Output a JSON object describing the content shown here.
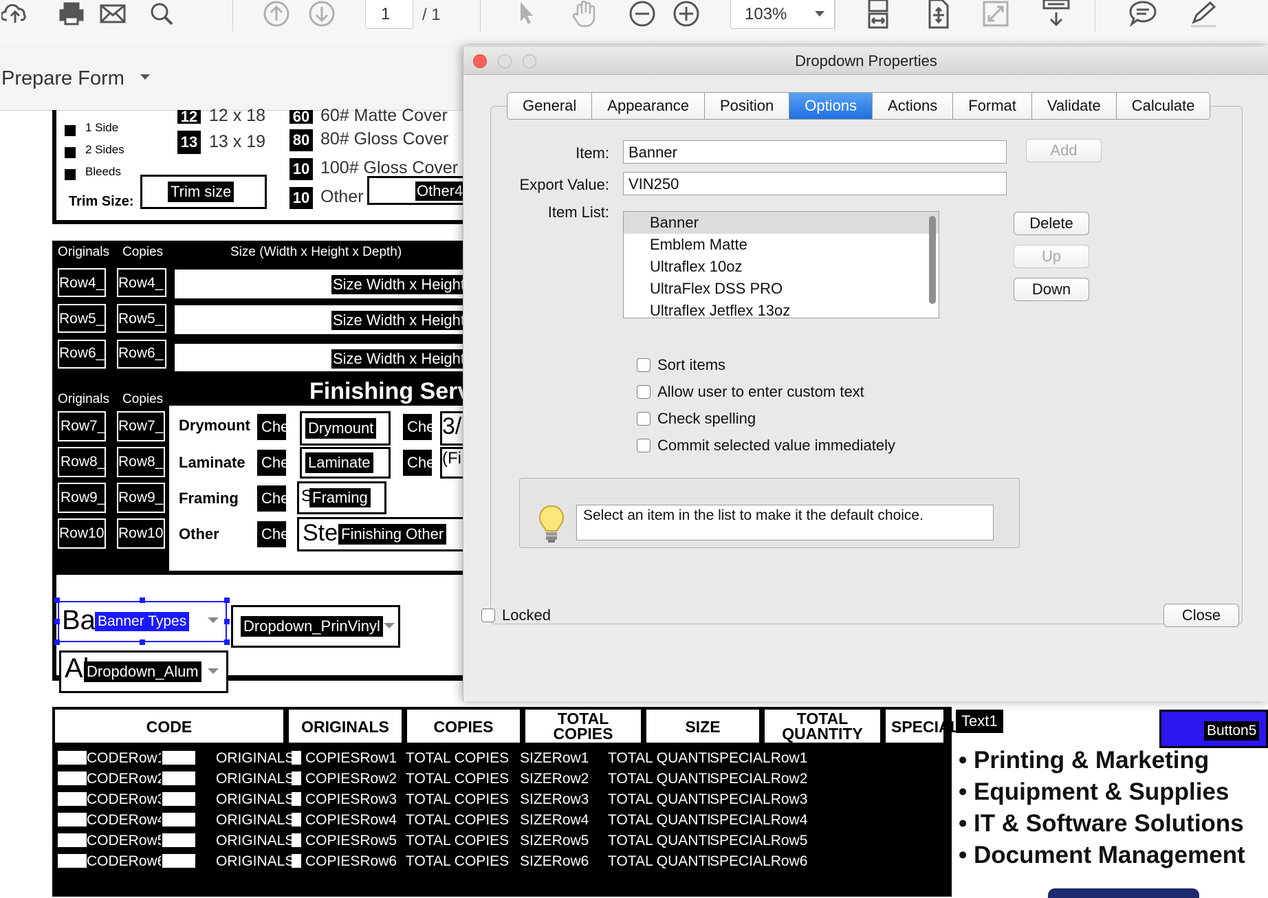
{
  "toolbar": {
    "icons": [
      "cloud-upload-icon",
      "print-icon",
      "mail-icon",
      "search-icon",
      "page-up-icon",
      "page-down-icon",
      "select-arrow-icon",
      "hand-icon",
      "zoom-out-icon",
      "zoom-in-icon",
      "fit-width-icon",
      "fit-page-icon",
      "full-screen-icon",
      "scroll-mode-icon",
      "comment-icon",
      "pen-icon"
    ],
    "page_current": "1",
    "page_total": "/ 1",
    "zoom": "103%"
  },
  "prepare_form": {
    "title": "Prepare Form"
  },
  "form": {
    "sides": [
      "1 Side",
      "2 Sides",
      "Bleeds"
    ],
    "trim_size_label": "Trim Size:",
    "trim_size_field": "Trim size",
    "sizes": [
      {
        "num": "12",
        "label": "12 x 18"
      },
      {
        "num": "13",
        "label": "13 x 19"
      }
    ],
    "stocks": [
      {
        "num": "60",
        "label": "60# Matte Cover"
      },
      {
        "num": "80",
        "label": "80# Gloss Cover"
      },
      {
        "num": "10",
        "label": "100# Gloss Cover"
      },
      {
        "num": "10",
        "label": "Other"
      }
    ],
    "other_field": "Other4",
    "size_header": {
      "originals": "Originals",
      "copies": "Copies",
      "size": "Size (Width x Height x Depth)"
    },
    "size_rows": [
      {
        "orig": "Row4_",
        "copy": "Row4_",
        "size": "Size Width x Height"
      },
      {
        "orig": "Row5_",
        "copy": "Row5_",
        "size": "Size Width x Height"
      },
      {
        "orig": "Row6_",
        "copy": "Row6_",
        "size": "Size Width x Height"
      }
    ],
    "finishing_header": {
      "originals": "Originals",
      "copies": "Copies",
      "title": "Finishing Serv"
    },
    "finishing_rows": [
      {
        "orig": "Row7_",
        "copy": "Row7_",
        "label": "Drymount",
        "chk": "Che",
        "field": "Drymount",
        "chk2": "Che",
        "extra": "3/"
      },
      {
        "orig": "Row8_",
        "copy": "Row8_",
        "label": "Laminate",
        "chk": "Che",
        "field": "Laminate",
        "chk2": "Che",
        "extra": "(Fi"
      },
      {
        "orig": "Row9_",
        "copy": "Row9_",
        "label": "Framing",
        "chk": "Che",
        "field": "Framing",
        "chk2": "",
        "extra": ""
      },
      {
        "orig": "Row10",
        "copy": "Row10",
        "label": "Other",
        "chk": "Che",
        "field": "Finishing Other",
        "chk2": "",
        "extra": ""
      }
    ],
    "framing_prefix": "S",
    "other_prefix": "Ste",
    "banner_types_under": "Ba",
    "banner_types": "Banner Types",
    "dropdown_prinvinyl": "Dropdown_PrinVinyl",
    "dropdown_alum_under": "Al",
    "dropdown_alum": "Dropdown_Alum"
  },
  "dialog": {
    "title": "Dropdown Properties",
    "tabs": [
      "General",
      "Appearance",
      "Position",
      "Options",
      "Actions",
      "Format",
      "Validate",
      "Calculate"
    ],
    "active_tab": "Options",
    "item_label": "Item:",
    "item_value": "Banner",
    "export_label": "Export Value:",
    "export_value": "VIN250",
    "list_label": "Item List:",
    "items": [
      "Banner",
      "Emblem Matte",
      "Ultraflex 10oz",
      "UltraFlex DSS PRO",
      "Ultraflex Jetflex 13oz"
    ],
    "buttons": {
      "add": "Add",
      "delete": "Delete",
      "up": "Up",
      "down": "Down",
      "close": "Close"
    },
    "checkboxes": [
      "Sort items",
      "Allow user to enter custom text",
      "Check spelling",
      "Commit selected value immediately"
    ],
    "hint": "Select an item in the list to make it the default choice.",
    "locked": "Locked"
  },
  "table": {
    "headers": [
      [
        "CODE"
      ],
      [
        "ORIGINALS"
      ],
      [
        "COPIES"
      ],
      [
        "TOTAL",
        "COPIES"
      ],
      [
        "SIZE"
      ],
      [
        "TOTAL",
        "QUANTITY"
      ],
      [
        "SPECIAL"
      ]
    ],
    "rows": [
      [
        "CODERow1",
        "ORIGINALS",
        "COPIESRow1",
        "TOTAL COPIES",
        "SIZERow1",
        "TOTAL QUANTIT",
        "SPECIALRow1"
      ],
      [
        "CODERow2",
        "ORIGINALS",
        "COPIESRow2",
        "TOTAL COPIES",
        "SIZERow2",
        "TOTAL QUANTIT",
        "SPECIALRow2"
      ],
      [
        "CODERow3",
        "ORIGINALS",
        "COPIESRow3",
        "TOTAL COPIES",
        "SIZERow3",
        "TOTAL QUANTIT",
        "SPECIALRow3"
      ],
      [
        "CODERow4",
        "ORIGINALS",
        "COPIESRow4",
        "TOTAL COPIES",
        "SIZERow4",
        "TOTAL QUANTIT",
        "SPECIALRow4"
      ],
      [
        "CODERow5",
        "ORIGINALS",
        "COPIESRow5",
        "TOTAL COPIES",
        "SIZERow5",
        "TOTAL QUANTIT",
        "SPECIALRow5"
      ],
      [
        "CODERow6",
        "ORIGINALS",
        "COPIESRow6",
        "TOTAL COPIES",
        "SIZERow6",
        "TOTAL QUANTIT",
        "SPECIALRow6"
      ]
    ]
  },
  "side": {
    "text1": "Text1",
    "button5": "Button5",
    "promo": [
      "Printing & Marketing",
      "Equipment & Supplies",
      "IT & Software Solutions",
      "Document Management"
    ]
  },
  "colors": {
    "selection": "#1a1aff",
    "button5": "#2b16ee",
    "accent_tab": "#1f6fe0"
  }
}
